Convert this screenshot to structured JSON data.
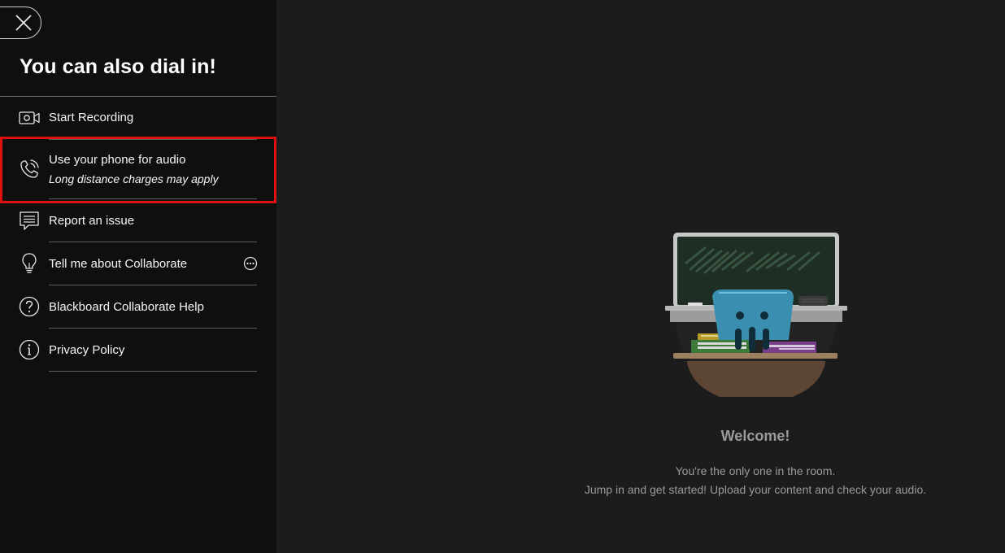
{
  "panel": {
    "title": "You can also dial in!",
    "items": [
      {
        "label": "Start Recording",
        "icon": "video-camera-icon"
      },
      {
        "label": "Use your phone for audio",
        "sublabel": "Long distance charges may apply",
        "icon": "phone-icon"
      },
      {
        "label": "Report an issue",
        "icon": "chat-report-icon"
      },
      {
        "label": "Tell me about Collaborate",
        "icon": "lightbulb-icon",
        "action_icon": "more-options-icon"
      },
      {
        "label": "Blackboard Collaborate Help",
        "icon": "question-circle-icon"
      },
      {
        "label": "Privacy Policy",
        "icon": "info-circle-icon"
      }
    ],
    "highlight_color": "#e01010"
  },
  "main": {
    "welcome_title": "Welcome!",
    "welcome_line1": "You're the only one in the room.",
    "welcome_line2": "Jump in and get started! Upload your content and check your audio."
  }
}
